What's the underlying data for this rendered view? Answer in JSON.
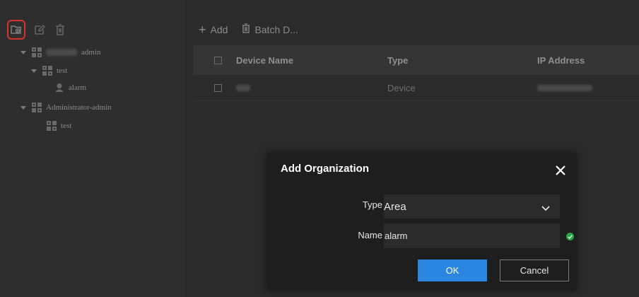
{
  "sidebar": {
    "toolbar": {
      "icons": [
        "add-organization-icon",
        "edit-icon",
        "delete-icon"
      ]
    },
    "tree": [
      {
        "label": "admin",
        "level": 0,
        "icon": "organization-icon",
        "expanded": true
      },
      {
        "label": "test",
        "level": 1,
        "icon": "organization-icon",
        "expanded": true
      },
      {
        "label": "alarm",
        "level": 2,
        "icon": "user-icon"
      },
      {
        "label": "Administrator-admin",
        "level": 0,
        "icon": "organization-icon",
        "expanded": true
      },
      {
        "label": "test",
        "level": 1,
        "icon": "organization-icon"
      }
    ]
  },
  "main": {
    "toolbar": {
      "add_label": "Add",
      "batch_delete_label": "Batch D..."
    },
    "table": {
      "columns": [
        "Device Name",
        "Type",
        "IP Address"
      ],
      "rows": [
        {
          "type": "Device"
        }
      ]
    }
  },
  "dialog": {
    "title": "Add Organization",
    "type_label": "Type",
    "type_value": "Area",
    "name_label": "Name",
    "name_value": "alarm",
    "ok_label": "OK",
    "cancel_label": "Cancel"
  },
  "colors": {
    "accent": "#2a86e0",
    "highlight": "#d6322e",
    "valid": "#27a744"
  }
}
